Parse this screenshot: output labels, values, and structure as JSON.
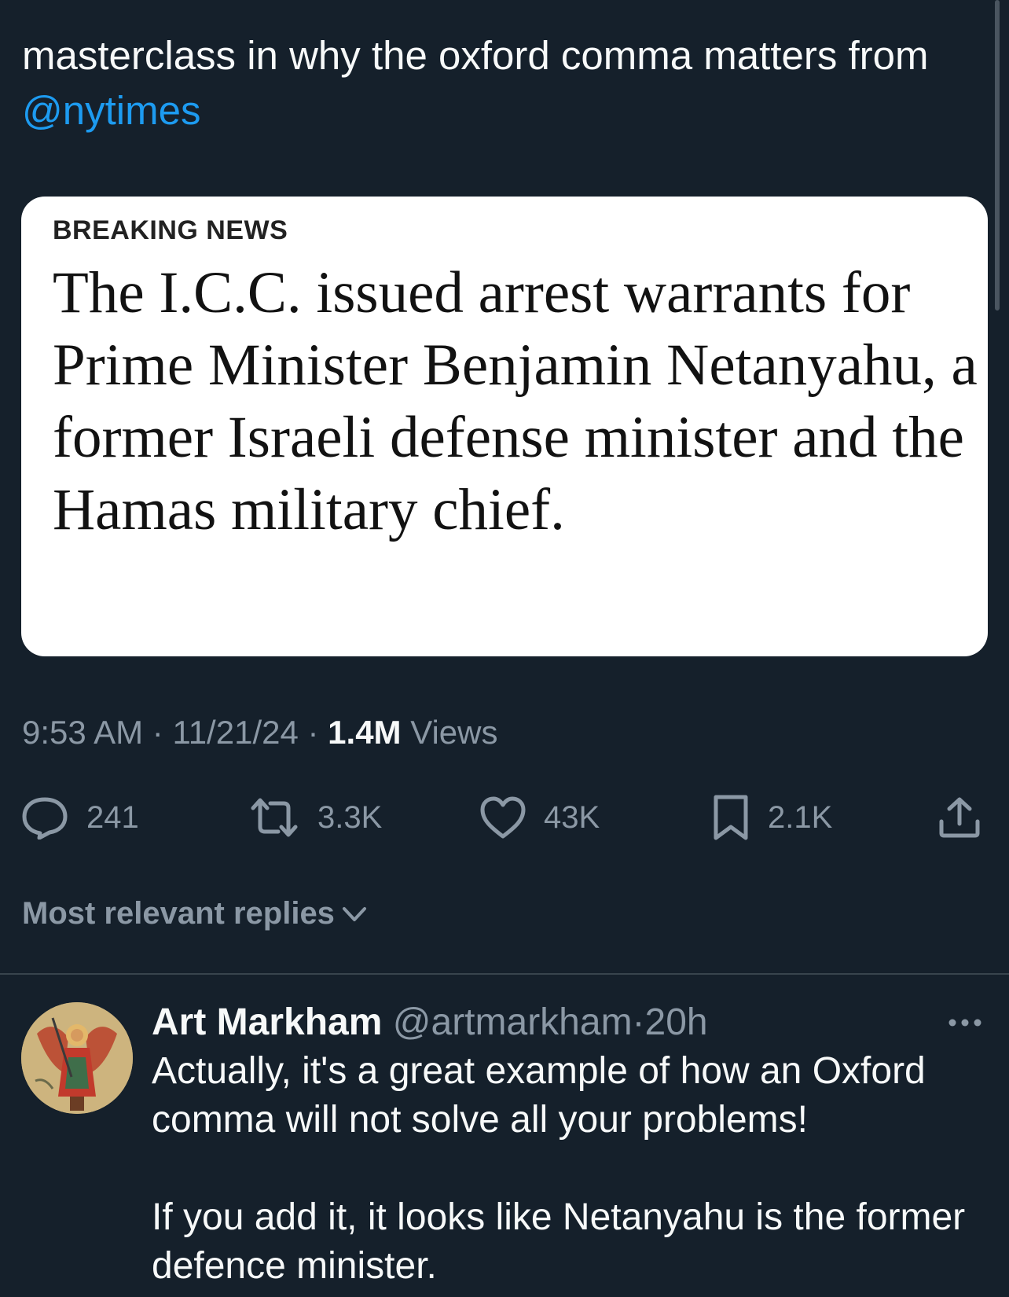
{
  "tweet": {
    "text": "masterclass in why the oxford comma matters from ",
    "mention": "@nytimes",
    "media": {
      "kicker": "BREAKING NEWS",
      "headline": "The I.C.C. issued arrest warrants for Prime Minister Benjamin Netanyahu, a former Israeli defense minister and the Hamas military chief."
    },
    "time": "9:53 AM",
    "date": "11/21/24",
    "views_count": "1.4M",
    "views_label": "Views",
    "separator": "·"
  },
  "actions": {
    "replies": "241",
    "retweets": "3.3K",
    "likes": "43K",
    "bookmarks": "2.1K"
  },
  "replies_sort": {
    "label": "Most relevant replies"
  },
  "reply": {
    "author_name": "Art Markham",
    "author_handle": "@artmarkham",
    "separator": "·",
    "time": "20h",
    "text_p1": "Actually, it's a great example of how an Oxford comma will not solve all your problems!",
    "text_p2": "If you add it, it looks like Netanyahu is the former defence minister."
  },
  "icons": {
    "reply": "speech-bubble-icon",
    "retweet": "retweet-arrows-icon",
    "like": "heart-icon",
    "bookmark": "bookmark-icon",
    "share": "share-upload-icon",
    "more": "ellipsis-icon",
    "sort": "chevron-down-icon"
  },
  "colors": {
    "background": "#15202b",
    "text": "#f7f9f9",
    "secondary": "#8b98a5",
    "link": "#1d9bf0",
    "divider": "#38444d",
    "card": "#ffffff"
  }
}
